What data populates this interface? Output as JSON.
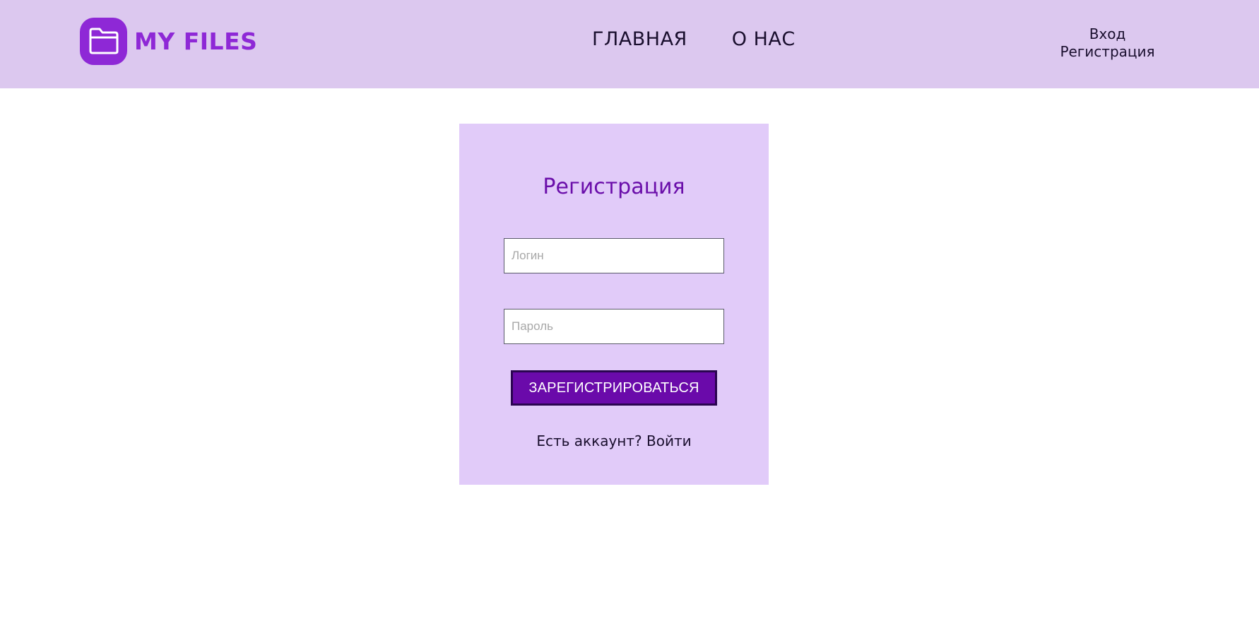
{
  "header": {
    "logo_text": "MY FILES",
    "nav": [
      {
        "label": "ГЛАВНАЯ"
      },
      {
        "label": "О НАС"
      }
    ],
    "auth": {
      "login_label": "Вход",
      "register_label": "Регистрация"
    }
  },
  "form": {
    "title": "Регистрация",
    "login_placeholder": "Логин",
    "password_placeholder": "Пароль",
    "submit_label": "ЗАРЕГИСТРИРОВАТЬСЯ",
    "have_account_text": "Есть аккаунт?",
    "login_link_label": "Войти"
  },
  "colors": {
    "header_bg": "#dcc8ef",
    "brand": "#8e28d6",
    "card_bg": "#e1cbf9",
    "button_bg": "#6a0aaa"
  },
  "icons": {
    "logo": "folder-icon"
  }
}
